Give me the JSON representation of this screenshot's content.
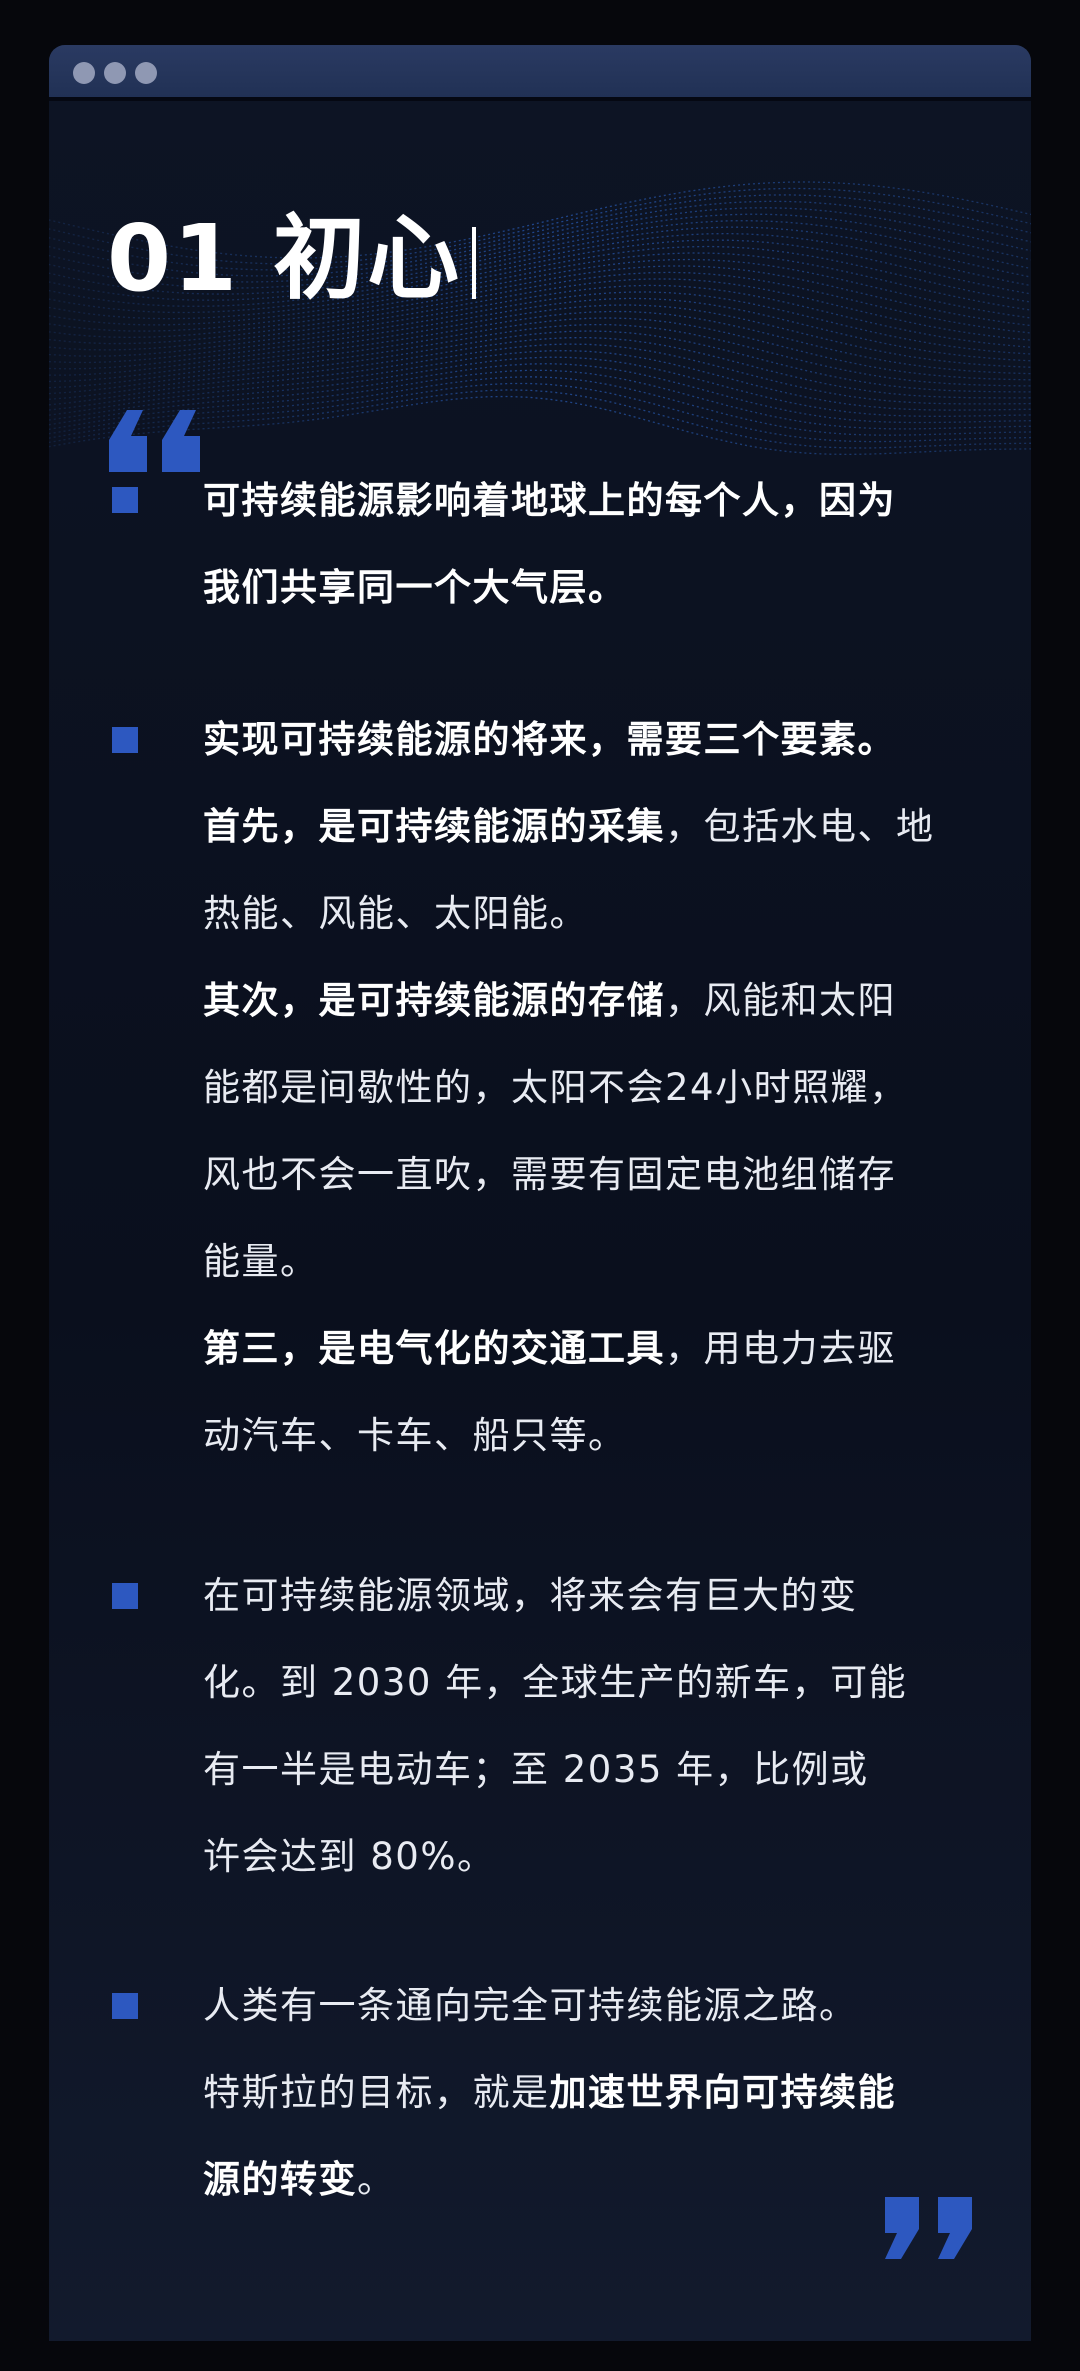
{
  "section": {
    "number": "01",
    "title": "初心"
  },
  "bullets": {
    "b1": {
      "l1": "可持续能源影响着地球上的每个人，因为",
      "l2": "我们共享同一个大气层。"
    },
    "b2": {
      "l1": "实现可持续能源的将来，需要三个要素。",
      "l2_bold": "首先，是可持续能源的采集",
      "l2_rest": "，包括水电、地",
      "l3": "热能、风能、太阳能。",
      "l4_bold": "其次，是可持续能源的存储",
      "l4_rest": "，风能和太阳",
      "l5": "能都是间歇性的，太阳不会24小时照耀，",
      "l6": "风也不会一直吹，需要有固定电池组储存",
      "l7": "能量。",
      "l8_bold": "第三，是电气化的交通工具",
      "l8_rest": "，用电力去驱",
      "l9": "动汽车、卡车、船只等。"
    },
    "b3": {
      "l1": "在可持续能源领域，将来会有巨大的变",
      "l2": "化。到 2030 年，全球生产的新车，可能",
      "l3": "有一半是电动车；至 2035 年，比例或",
      "l4": "许会达到 80%。"
    },
    "b4": {
      "l1": "人类有一条通向完全可持续能源之路。",
      "l2_rest": "特斯拉的目标，就是",
      "l2_bold": "加速世界向可持续能",
      "l3_bold": "源的转变",
      "l3_rest": "。"
    }
  },
  "colors": {
    "accent": "#2d58c0",
    "text": "#ffffff",
    "background": "#0a0f1d",
    "titlebar": "#243459"
  }
}
